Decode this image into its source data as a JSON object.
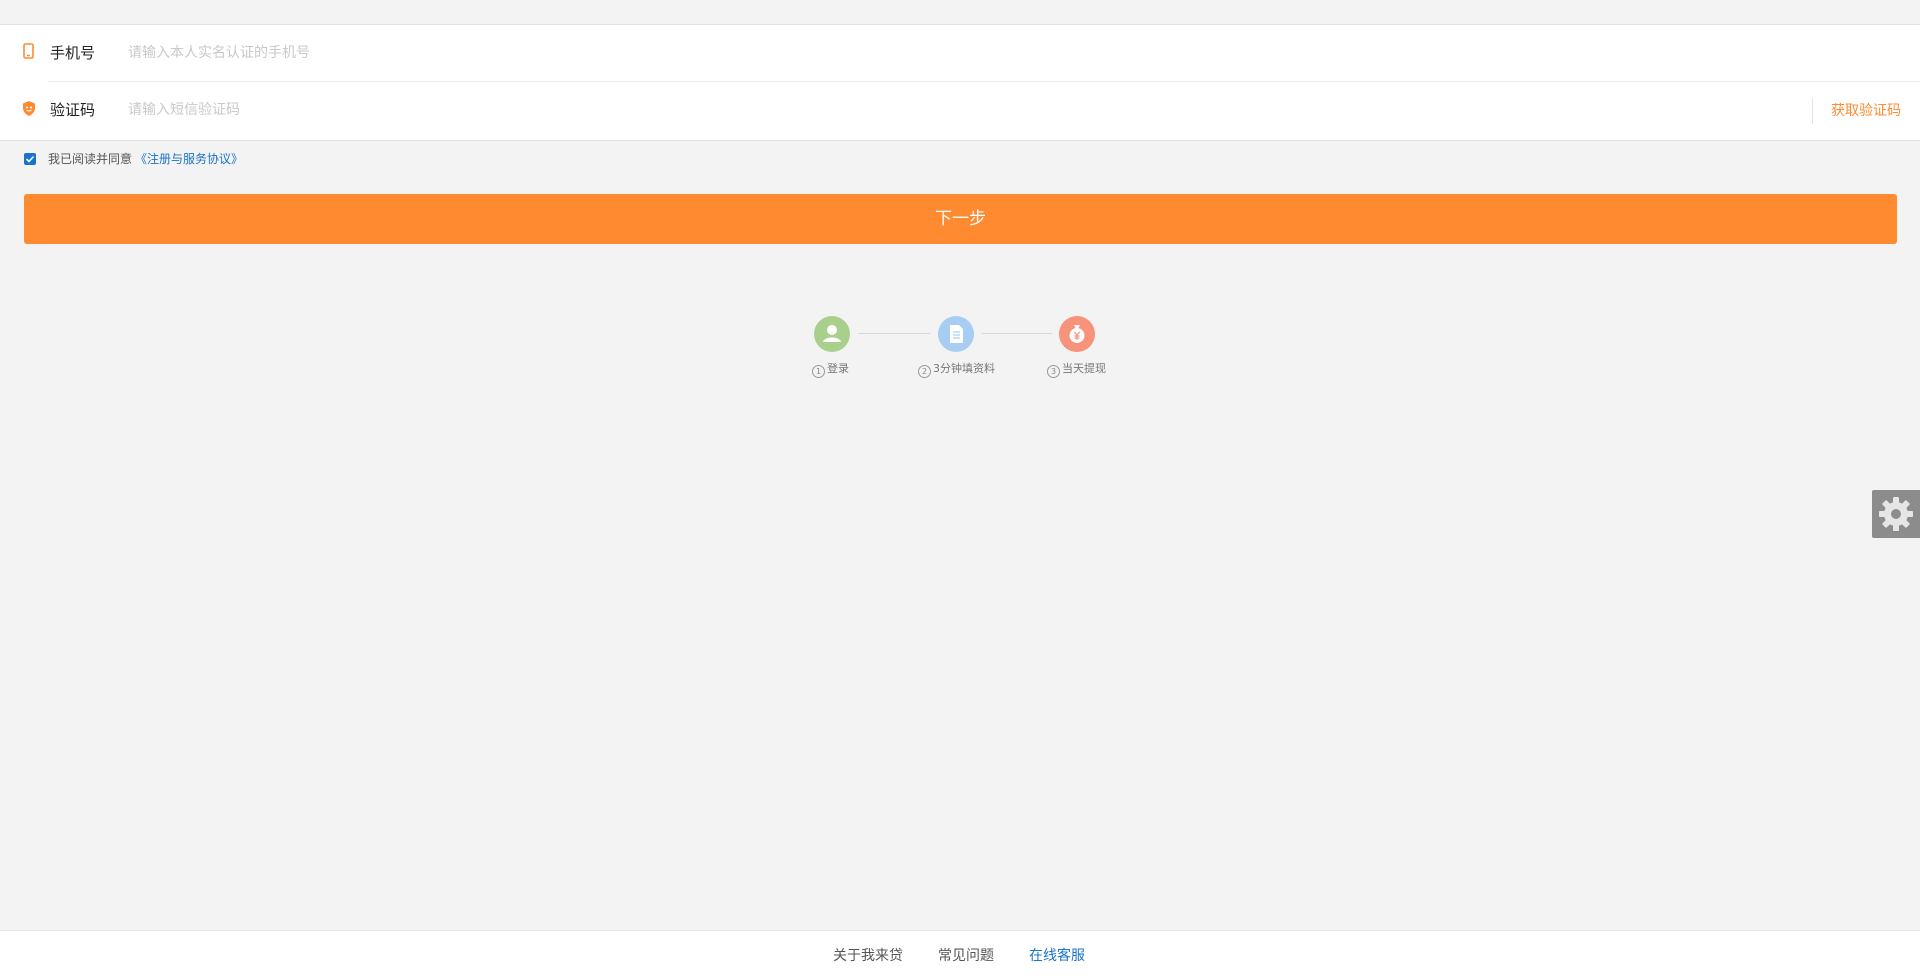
{
  "form": {
    "phone": {
      "label": "手机号",
      "value": "",
      "placeholder": "请输入本人实名认证的手机号"
    },
    "code": {
      "label": "验证码",
      "value": "",
      "placeholder": "请输入短信验证码",
      "get_code_label": "获取验证码"
    }
  },
  "agreement": {
    "checked": true,
    "text": "我已阅读并同意",
    "link_text": "《注册与服务协议》"
  },
  "next_button": {
    "label": "下一步"
  },
  "steps": [
    {
      "number": "1",
      "label": "登录",
      "icon": "user-icon",
      "color": "#a9cf8d"
    },
    {
      "number": "2",
      "label": "3分钟填资料",
      "icon": "document-icon",
      "color": "#a8cdf3"
    },
    {
      "number": "3",
      "label": "当天提现",
      "icon": "money-bag-icon",
      "color": "#f6937a"
    }
  ],
  "floating": {
    "icon": "gear-icon"
  },
  "footer": {
    "links": [
      {
        "label": "关于我来贷"
      },
      {
        "label": "常见问题"
      },
      {
        "label": "在线客服"
      }
    ]
  },
  "colors": {
    "accent": "#ff8a30",
    "link": "#1a73c9",
    "background": "#f3f3f3"
  }
}
